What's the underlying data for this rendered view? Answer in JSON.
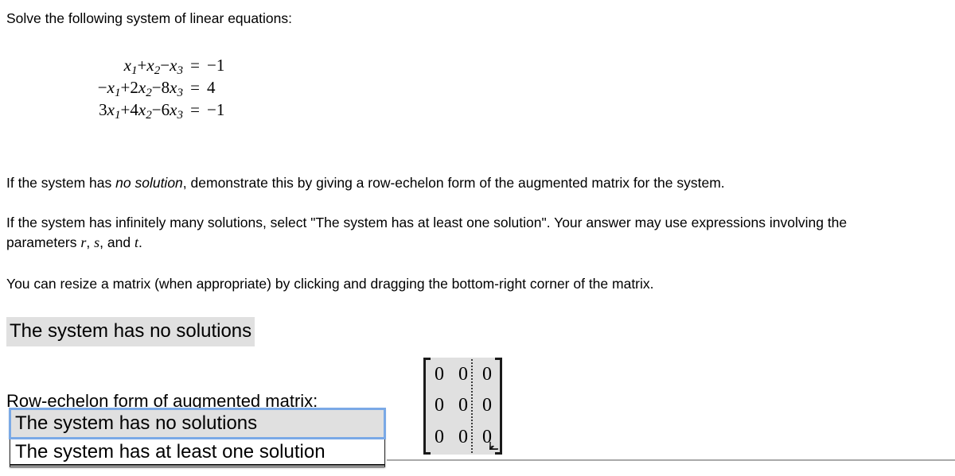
{
  "prompt": {
    "intro": "Solve the following system of linear equations:",
    "no_solution_instruction_pre": "If the system has ",
    "no_solution_instruction_em": "no solution",
    "no_solution_instruction_post": ", demonstrate this by giving a row-echelon form of the augmented matrix for the system.",
    "infinite_instruction_pre": "If the system has infinitely many solutions, select \"The system has at least one solution\". Your answer may use expressions involving the parameters ",
    "param_r": "r",
    "param_comma_1": ", ",
    "param_s": "s",
    "param_and": ", and ",
    "param_t": "t",
    "param_period": ".",
    "resize_instruction": "You can resize a matrix (when appropriate) by clicking and dragging the bottom-right corner of the matrix."
  },
  "equations": [
    {
      "lhs_terms": [
        "x",
        "1",
        "+",
        "x",
        "2",
        "−",
        "x",
        "3"
      ],
      "lhs": "x₁+x₂−x₃",
      "eq": "=",
      "rhs": "−1"
    },
    {
      "lhs": "−x₁+2x₂−8x₃",
      "eq": "=",
      "rhs": "4"
    },
    {
      "lhs": "3x₁+4x₂−6x₃",
      "eq": "=",
      "rhs": "−1"
    }
  ],
  "equation_parts": [
    {
      "id": "eq1",
      "coef1": "",
      "v1": "x",
      "s1": "1",
      "op1": "+",
      "coef2": "",
      "v2": "x",
      "s2": "2",
      "op2": "−",
      "coef3": "",
      "v3": "x",
      "s3": "3",
      "eq": "=",
      "rhs": "−1"
    },
    {
      "id": "eq2",
      "coef1": "−",
      "v1": "x",
      "s1": "1",
      "op1": "+",
      "coef2": "2",
      "v2": "x",
      "s2": "2",
      "op2": "−",
      "coef3": "8",
      "v3": "x",
      "s3": "3",
      "eq": "=",
      "rhs": "4"
    },
    {
      "id": "eq3",
      "coef1": "3",
      "v1": "x",
      "s1": "1",
      "op1": "+",
      "coef2": "4",
      "v2": "x",
      "s2": "2",
      "op2": "−",
      "coef3": "6",
      "v3": "x",
      "s3": "3",
      "eq": "=",
      "rhs": "−1"
    }
  ],
  "answer": {
    "selected_label": "The system has no solutions",
    "row_echelon_label": "Row-echelon form of augmented matrix:"
  },
  "dropdown": {
    "open": true,
    "options": [
      {
        "label": "The system has no solutions",
        "selected": true
      },
      {
        "label": "The system has at least one solution",
        "selected": false
      }
    ],
    "highlight_color": "#7aa9e6",
    "selected_bg": "#e0e0e0"
  },
  "matrix": {
    "rows": 3,
    "cols": 3,
    "augmented": true,
    "divider_after_col": 2,
    "values": [
      [
        "0",
        "0",
        "0"
      ],
      [
        "0",
        "0",
        "0"
      ],
      [
        "0",
        "0",
        "0"
      ]
    ],
    "background": "#e0e0e0",
    "resize_handle_icon": "resize-corner-arrow"
  }
}
